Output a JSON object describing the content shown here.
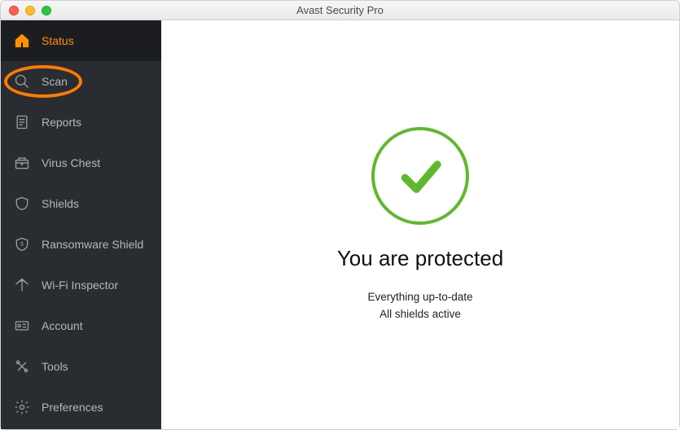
{
  "window": {
    "title": "Avast Security Pro"
  },
  "sidebar": {
    "items": [
      {
        "label": "Status"
      },
      {
        "label": "Scan"
      },
      {
        "label": "Reports"
      },
      {
        "label": "Virus Chest"
      },
      {
        "label": "Shields"
      },
      {
        "label": "Ransomware Shield"
      },
      {
        "label": "Wi-Fi Inspector"
      },
      {
        "label": "Account"
      },
      {
        "label": "Tools"
      },
      {
        "label": "Preferences"
      }
    ]
  },
  "status": {
    "heading": "You are protected",
    "line1": "Everything up-to-date",
    "line2": "All shields active"
  },
  "colors": {
    "accent": "#ff9100",
    "success": "#5fb92e",
    "sidebarBg": "#292c31"
  }
}
